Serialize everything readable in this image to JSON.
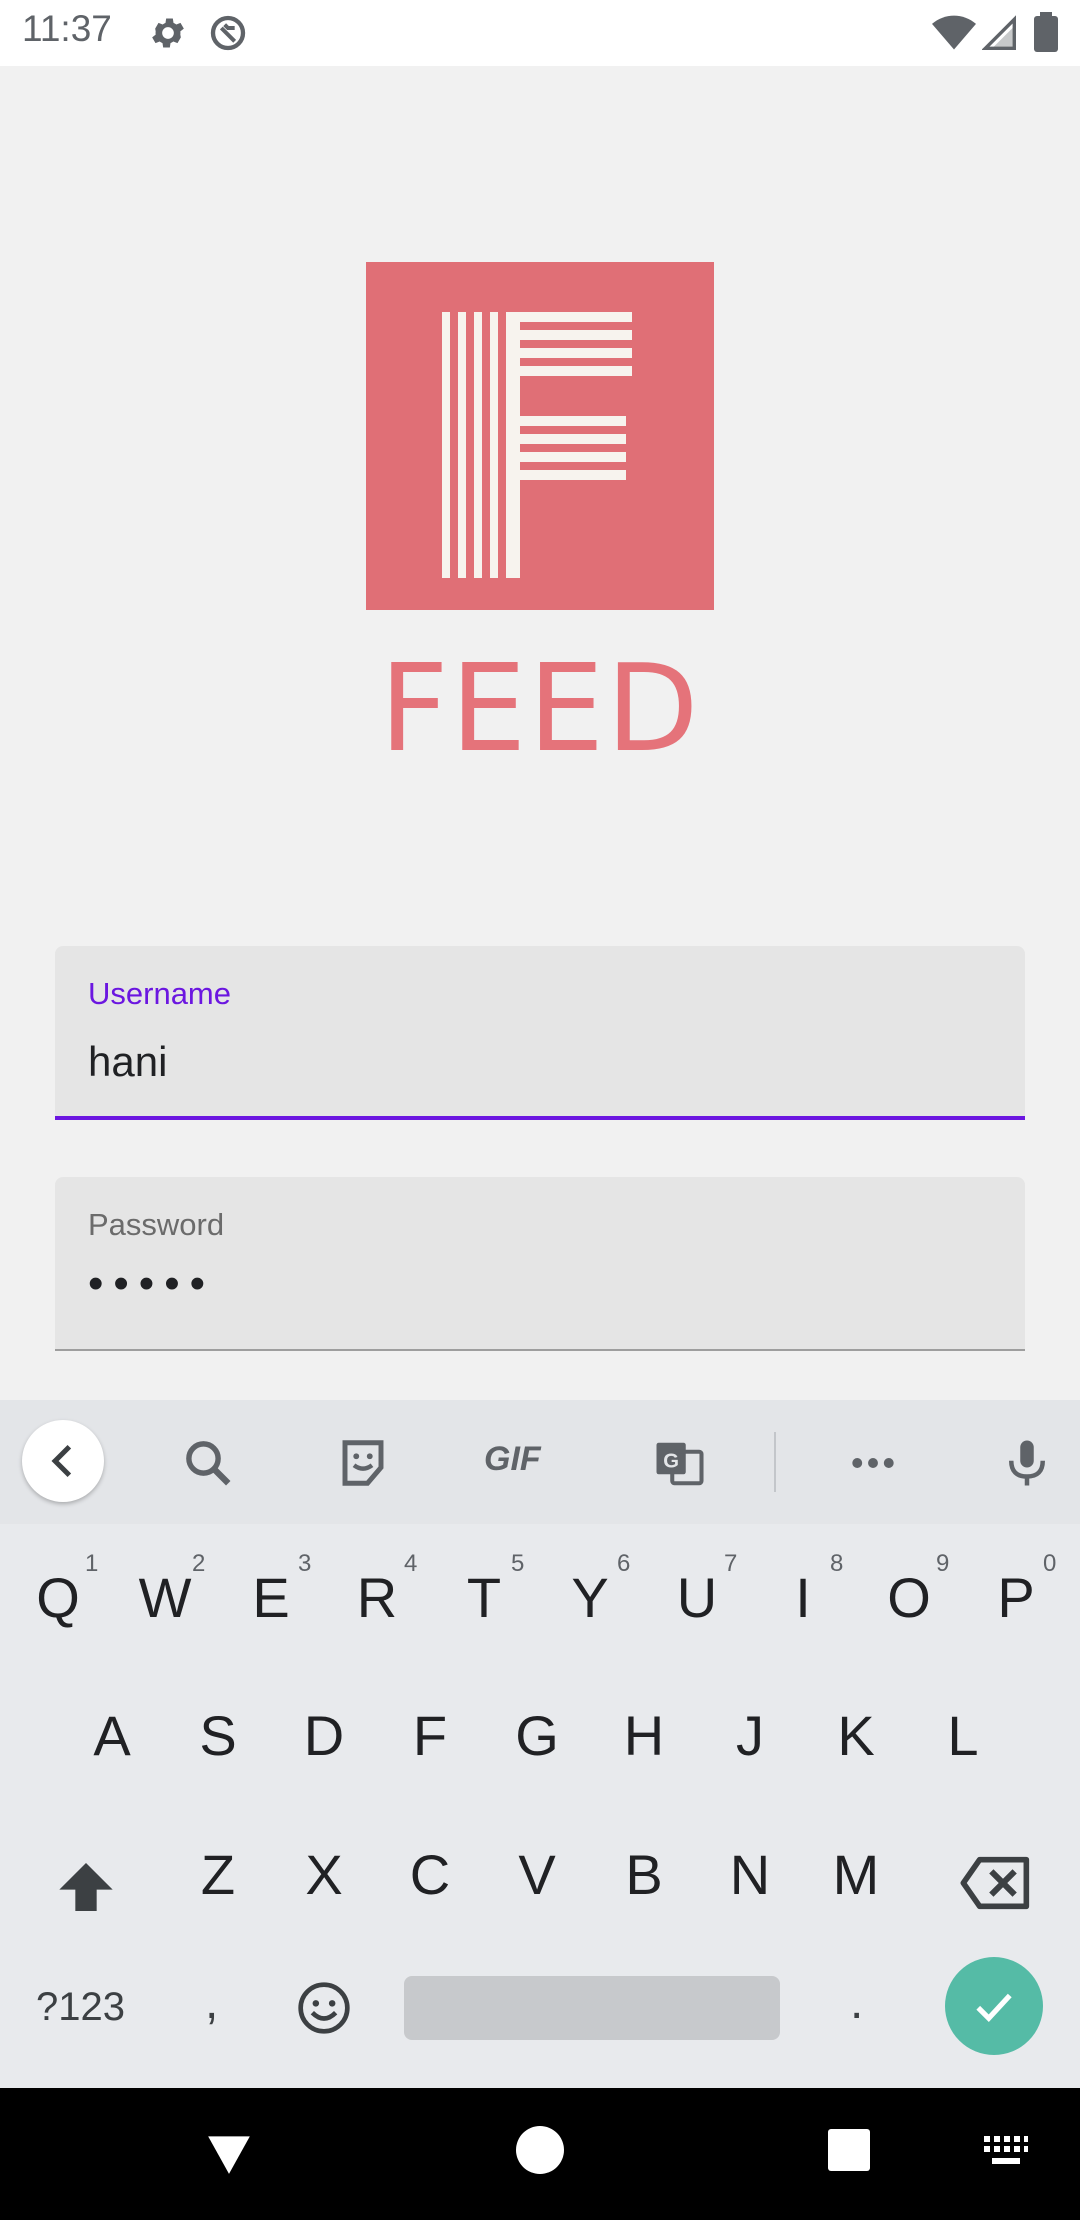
{
  "status_bar": {
    "time": "11:37",
    "icons": [
      "settings-icon",
      "sync-icon",
      "wifi-icon",
      "signal-icon",
      "battery-icon"
    ]
  },
  "brand": {
    "name": "FEED",
    "logo_color": "#e06f76"
  },
  "form": {
    "username": {
      "label": "Username",
      "value": "hani"
    },
    "password": {
      "label": "Password",
      "value": "•••••"
    }
  },
  "keyboard": {
    "toolbar": [
      "collapse-icon",
      "search-icon",
      "sticker-icon",
      "gif-icon",
      "translate-icon",
      "more-icon",
      "mic-icon"
    ],
    "gif_label": "GIF",
    "rows": [
      [
        "Q",
        "W",
        "E",
        "R",
        "T",
        "Y",
        "U",
        "I",
        "O",
        "P"
      ],
      [
        "A",
        "S",
        "D",
        "F",
        "G",
        "H",
        "J",
        "K",
        "L"
      ],
      [
        "Z",
        "X",
        "C",
        "V",
        "B",
        "N",
        "M"
      ]
    ],
    "hints": [
      "1",
      "2",
      "3",
      "4",
      "5",
      "6",
      "7",
      "8",
      "9",
      "0"
    ],
    "sym_label": "?123",
    "comma": ",",
    "period": ".",
    "enter_color": "#55bba6"
  },
  "nav_bar": {
    "buttons": [
      "back-icon",
      "home-icon",
      "recents-icon",
      "keyboard-switch-icon"
    ]
  }
}
